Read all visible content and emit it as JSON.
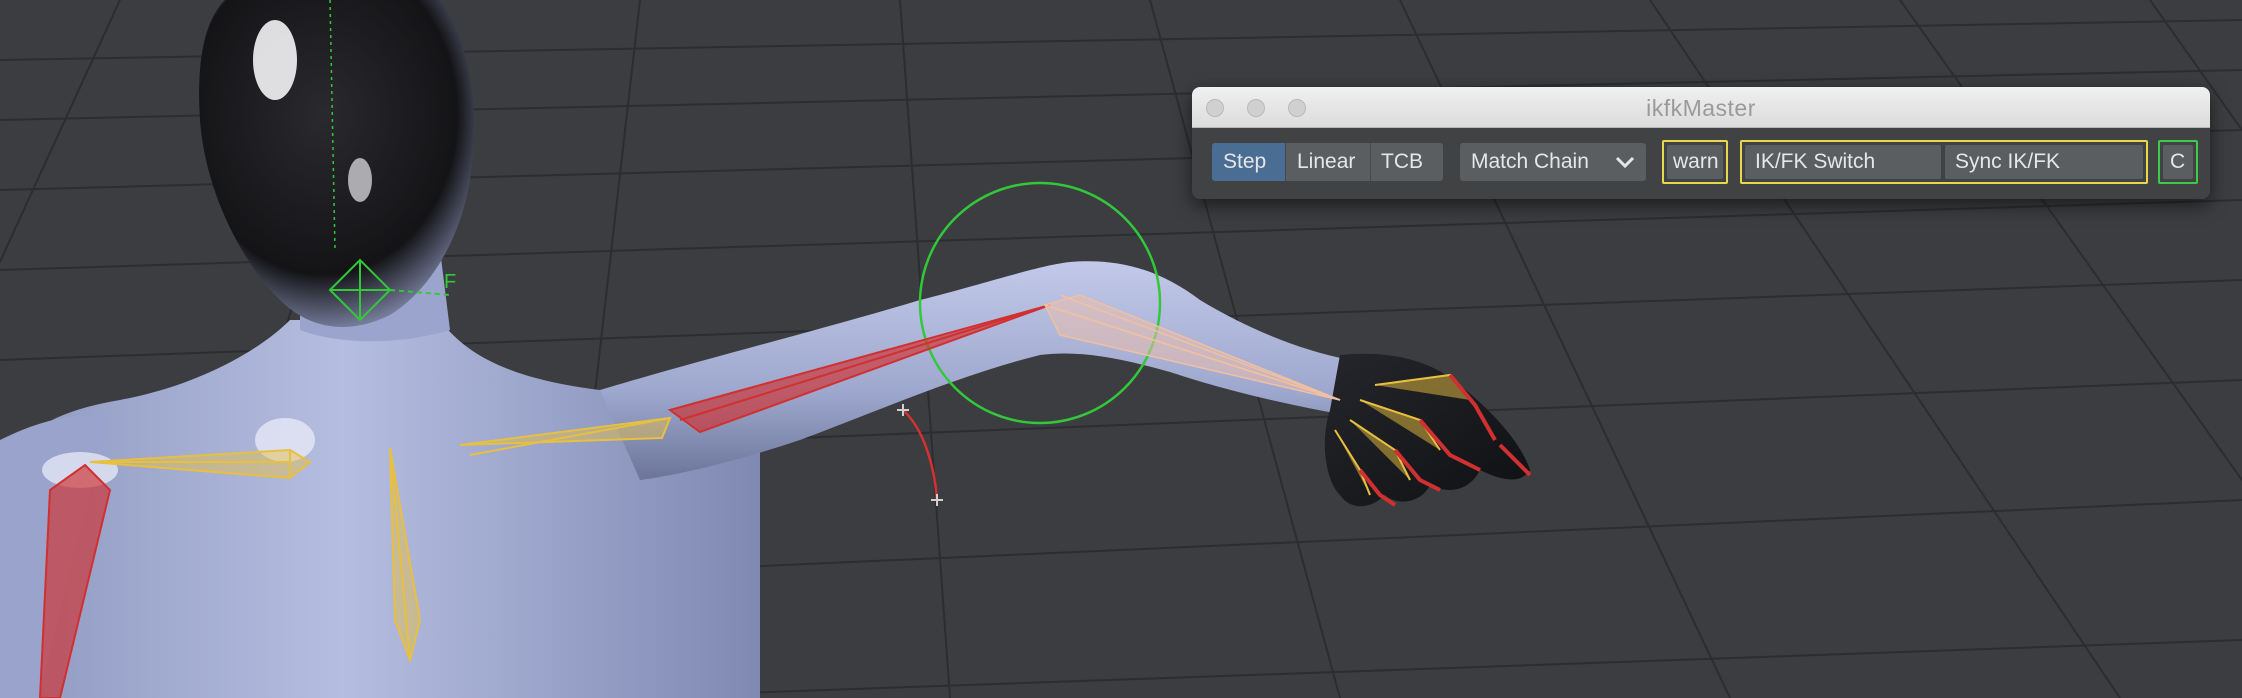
{
  "window": {
    "title": "ikfkMaster"
  },
  "toolbar": {
    "interpolation_modes": [
      "Step",
      "Linear",
      "TCB"
    ],
    "active_mode": "Step",
    "match_dropdown": {
      "selected": "Match Chain"
    },
    "warn_label": "warn",
    "ikfk_switch_label": "IK/FK Switch",
    "sync_label": "Sync IK/FK",
    "c_label": "C"
  },
  "viewport": {
    "chin_marker_label": "F"
  },
  "colors": {
    "active_segment": "#4a6d93",
    "warn_frame": "#e6d84a",
    "c_frame": "#3fc94a",
    "fk_bone": "#e8c040",
    "ik_bone": "#d03030",
    "control_circle": "#32c83a"
  }
}
